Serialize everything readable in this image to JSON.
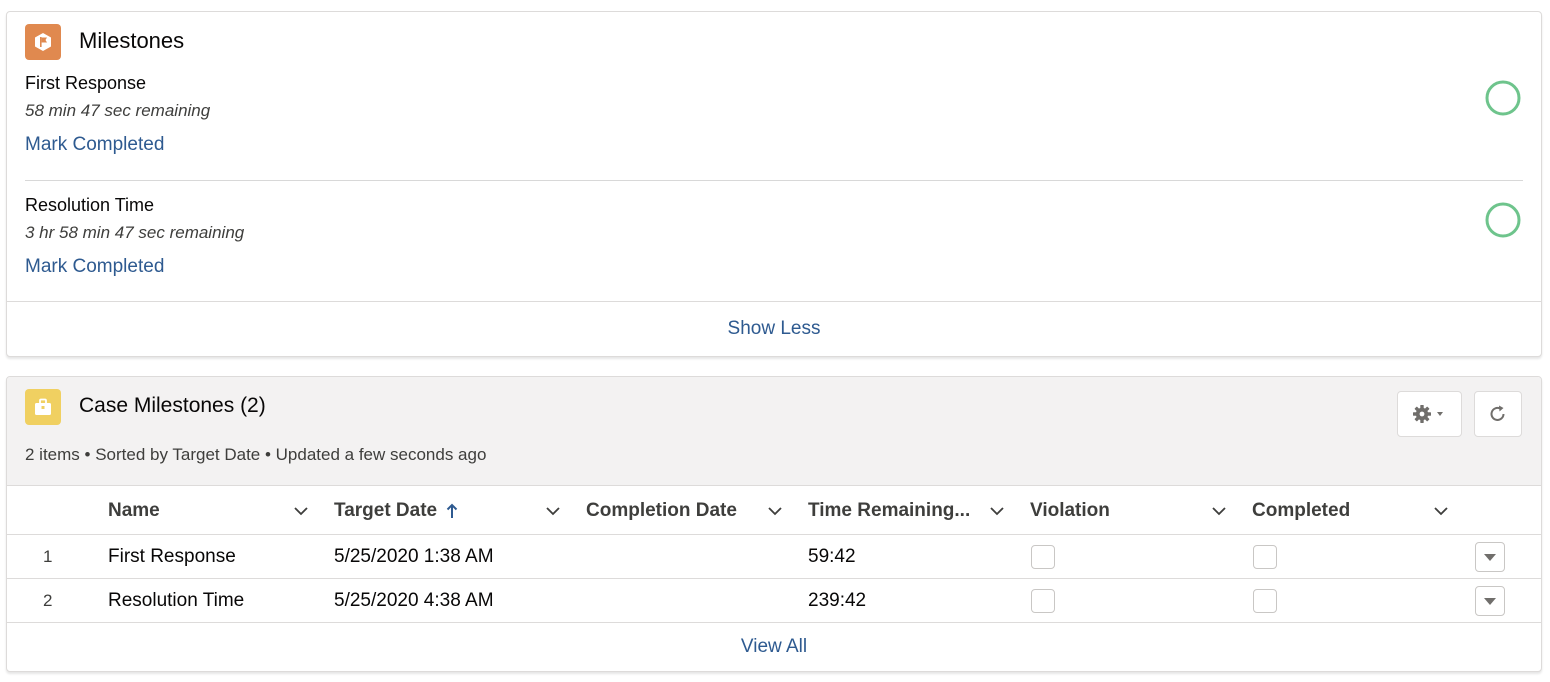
{
  "milestones_card": {
    "title": "Milestones",
    "icon": "flag-icon",
    "icon_color": "#E0894F",
    "ring_color": "#6EC48C",
    "items": [
      {
        "name": "First Response",
        "remaining": "58 min 47 sec remaining",
        "action": "Mark Completed"
      },
      {
        "name": "Resolution Time",
        "remaining": "3 hr 58 min 47 sec remaining",
        "action": "Mark Completed"
      }
    ],
    "footer_link": "Show Less"
  },
  "case_milestones_card": {
    "title": "Case Milestones (2)",
    "icon": "briefcase-icon",
    "icon_color": "#F0D061",
    "subtitle": "2 items • Sorted by Target Date • Updated a few seconds ago",
    "actions": {
      "settings": "gear-icon",
      "refresh": "refresh-icon"
    },
    "columns": [
      "Name",
      "Target Date",
      "Completion Date",
      "Time Remaining...",
      "Violation",
      "Completed"
    ],
    "sorted_column": "Target Date",
    "rows": [
      {
        "num": "1",
        "name": "First Response",
        "target_date": "5/25/2020 1:38 AM",
        "completion_date": "",
        "time_remaining": "59:42",
        "violation": false,
        "completed": false
      },
      {
        "num": "2",
        "name": "Resolution Time",
        "target_date": "5/25/2020 4:38 AM",
        "completion_date": "",
        "time_remaining": "239:42",
        "violation": false,
        "completed": false
      }
    ],
    "footer_link": "View All"
  },
  "colors": {
    "link": "#2E5A90",
    "border": "#DDDBDA",
    "header_bg": "#F3F2F2"
  }
}
